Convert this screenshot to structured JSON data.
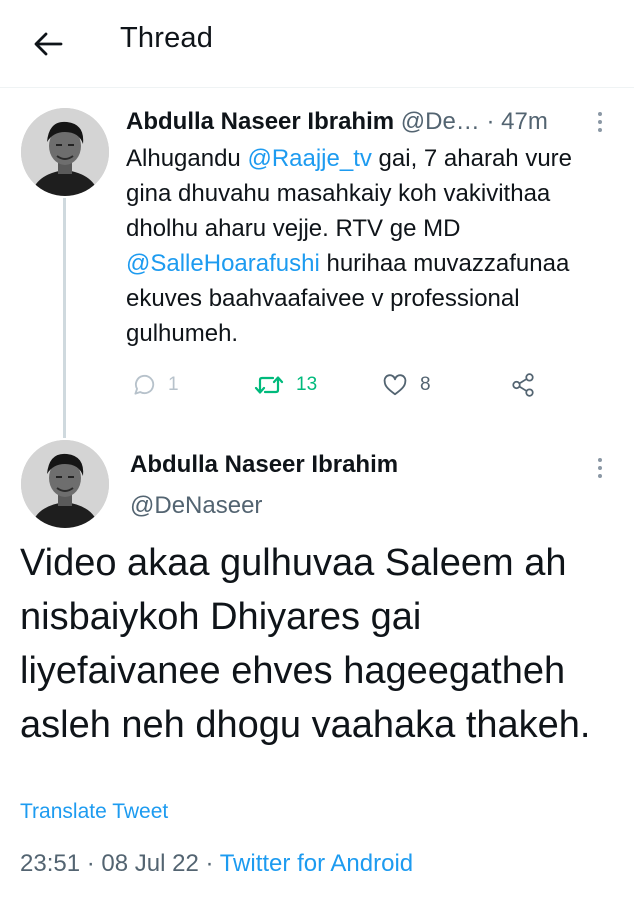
{
  "header": {
    "title": "Thread",
    "back_icon": "arrow-left-icon"
  },
  "tweet1": {
    "name": "Abdulla Naseer Ibrahim",
    "handle": "@De…",
    "separator": "·",
    "time": "47m",
    "body": [
      {
        "text": "Alhugandu "
      },
      {
        "text": "@Raajje_tv",
        "mention": true
      },
      {
        "text": " gai, 7 aharah vure gina dhuvahu masahkaiy koh vakivithaa dholhu aharu vejje. RTV ge MD "
      },
      {
        "text": "@SalleHoarafushi",
        "mention": true
      },
      {
        "text": " hurihaa muvazzafunaa ekuves baahvaafaivee v professional gulhumeh."
      }
    ],
    "actions": {
      "reply_count": "1",
      "retweet_count": "13",
      "like_count": "8"
    },
    "colors": {
      "retweeted": "#00ba7c",
      "mention": "#1d9bf0"
    }
  },
  "tweet2": {
    "name": "Abdulla Naseer Ibrahim",
    "handle": "@DeNaseer",
    "body": "Video akaa gulhuvaa Saleem ah nisbaiykoh Dhiyares gai liyefaivanee ehves hageegatheh asleh neh dhogu vaahaka thakeh.",
    "translate_label": "Translate Tweet",
    "time": "23:51",
    "date": "08 Jul 22",
    "separator": "·",
    "source": "Twitter for Android"
  }
}
